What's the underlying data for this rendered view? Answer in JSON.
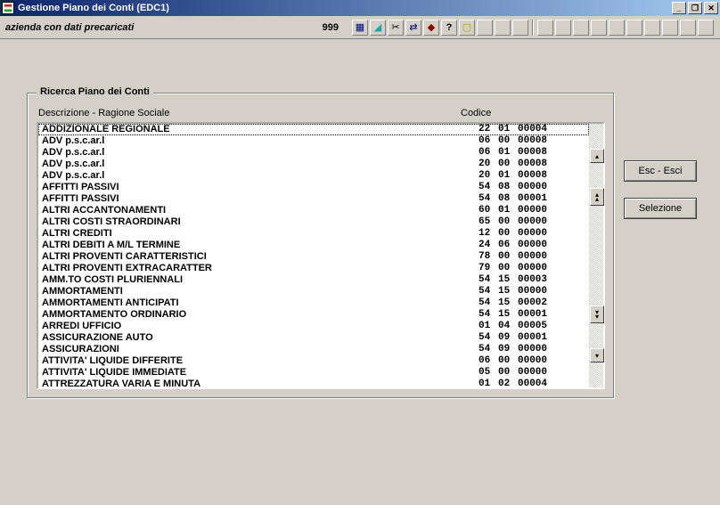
{
  "window": {
    "title": "Gestione Piano dei Conti (EDC1)"
  },
  "toolbar": {
    "company_label": "azienda con dati precaricati",
    "company_code": "999"
  },
  "group": {
    "legend": "Ricerca Piano dei Conti",
    "header_left": "Descrizione - Ragione Sociale",
    "header_right": "Codice"
  },
  "buttons": {
    "esc": "Esc - Esci",
    "select": "Selezione"
  },
  "rows": [
    {
      "desc": "ADDIZIONALE REGIONALE",
      "c1": "22",
      "c2": "01",
      "c3": "00004",
      "sel": true
    },
    {
      "desc": "ADV p.s.c.ar.l",
      "c1": "06",
      "c2": "00",
      "c3": "00008"
    },
    {
      "desc": "ADV p.s.c.ar.l",
      "c1": "06",
      "c2": "01",
      "c3": "00008"
    },
    {
      "desc": "ADV p.s.c.ar.l",
      "c1": "20",
      "c2": "00",
      "c3": "00008"
    },
    {
      "desc": "ADV p.s.c.ar.l",
      "c1": "20",
      "c2": "01",
      "c3": "00008"
    },
    {
      "desc": "AFFITTI PASSIVI",
      "c1": "54",
      "c2": "08",
      "c3": "00000"
    },
    {
      "desc": "AFFITTI PASSIVI",
      "c1": "54",
      "c2": "08",
      "c3": "00001"
    },
    {
      "desc": "ALTRI ACCANTONAMENTI",
      "c1": "60",
      "c2": "01",
      "c3": "00000"
    },
    {
      "desc": "ALTRI COSTI STRAORDINARI",
      "c1": "65",
      "c2": "00",
      "c3": "00000"
    },
    {
      "desc": "ALTRI CREDITI",
      "c1": "12",
      "c2": "00",
      "c3": "00000"
    },
    {
      "desc": "ALTRI DEBITI A M/L TERMINE",
      "c1": "24",
      "c2": "06",
      "c3": "00000"
    },
    {
      "desc": "ALTRI PROVENTI CARATTERISTICI",
      "c1": "78",
      "c2": "00",
      "c3": "00000"
    },
    {
      "desc": "ALTRI PROVENTI EXTRACARATTER",
      "c1": "79",
      "c2": "00",
      "c3": "00000"
    },
    {
      "desc": "AMM.TO COSTI PLURIENNALI",
      "c1": "54",
      "c2": "15",
      "c3": "00003"
    },
    {
      "desc": "AMMORTAMENTI",
      "c1": "54",
      "c2": "15",
      "c3": "00000"
    },
    {
      "desc": "AMMORTAMENTI ANTICIPATI",
      "c1": "54",
      "c2": "15",
      "c3": "00002"
    },
    {
      "desc": "AMMORTAMENTO ORDINARIO",
      "c1": "54",
      "c2": "15",
      "c3": "00001"
    },
    {
      "desc": "ARREDI UFFICIO",
      "c1": "01",
      "c2": "04",
      "c3": "00005"
    },
    {
      "desc": "ASSICURAZIONE  AUTO",
      "c1": "54",
      "c2": "09",
      "c3": "00001"
    },
    {
      "desc": "ASSICURAZIONI",
      "c1": "54",
      "c2": "09",
      "c3": "00000"
    },
    {
      "desc": "ATTIVITA' LIQUIDE DIFFERITE",
      "c1": "06",
      "c2": "00",
      "c3": "00000"
    },
    {
      "desc": "ATTIVITA' LIQUIDE IMMEDIATE",
      "c1": "05",
      "c2": "00",
      "c3": "00000"
    },
    {
      "desc": "ATTREZZATURA VARIA E MINUTA",
      "c1": "01",
      "c2": "02",
      "c3": "00004"
    }
  ]
}
